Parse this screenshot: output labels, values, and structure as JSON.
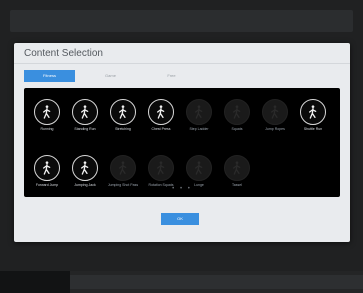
{
  "dialog": {
    "title": "Content Selection",
    "tabs": [
      {
        "label": "Fitness",
        "active": true
      },
      {
        "label": "Game",
        "active": false
      },
      {
        "label": "Free",
        "active": false
      }
    ],
    "ok_label": "OK",
    "pager": "• • •"
  },
  "tiles": [
    {
      "label": "Running",
      "icon": "running-icon",
      "locked": false
    },
    {
      "label": "Standing Run",
      "icon": "standing-run-icon",
      "locked": false
    },
    {
      "label": "Stretching",
      "icon": "stretching-icon",
      "locked": false
    },
    {
      "label": "Chest Press",
      "icon": "chest-press-icon",
      "locked": false
    },
    {
      "label": "Step Ladder",
      "icon": "step-ladder-icon",
      "locked": true
    },
    {
      "label": "Squats",
      "icon": "squats-icon",
      "locked": true
    },
    {
      "label": "Jump Ropes",
      "icon": "jump-ropes-icon",
      "locked": true
    },
    {
      "label": "Shuttle Run",
      "icon": "shuttle-run-icon",
      "locked": false
    },
    {
      "label": "Forward Jump",
      "icon": "forward-jump-icon",
      "locked": false
    },
    {
      "label": "Jumping Jack",
      "icon": "jumping-jack-icon",
      "locked": false
    },
    {
      "label": "Jumping Shot Pass",
      "icon": "jumping-shot-pass-icon",
      "locked": true
    },
    {
      "label": "Rotation Squats",
      "icon": "rotation-squats-icon",
      "locked": true
    },
    {
      "label": "Lunge",
      "icon": "lunge-icon",
      "locked": true
    },
    {
      "label": "Tassel",
      "icon": "tassel-icon",
      "locked": true
    }
  ],
  "colors": {
    "accent": "#3a8fdf",
    "panel": "#000000",
    "dialog": "#e9ebee"
  }
}
